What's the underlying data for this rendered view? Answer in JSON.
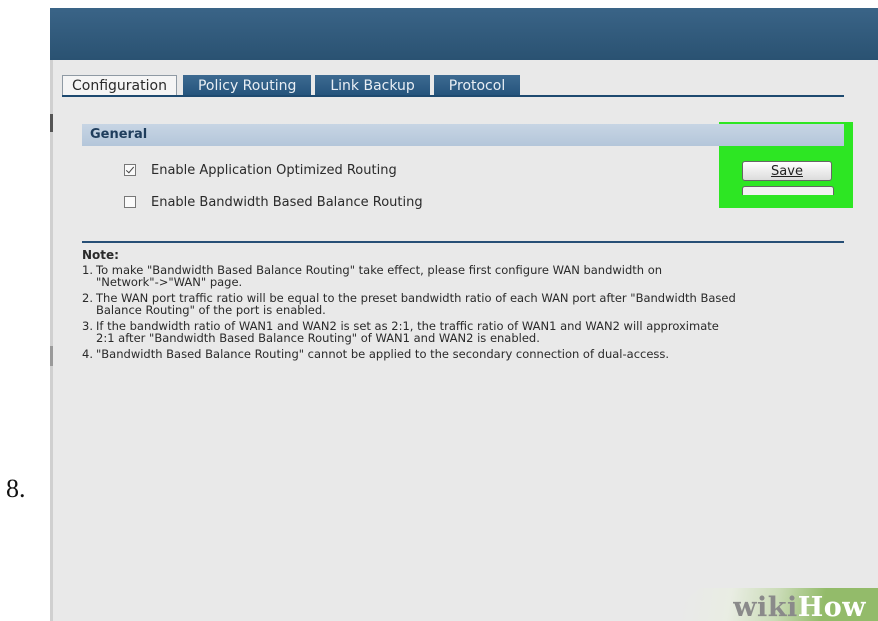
{
  "step_number": "8.",
  "tabs": [
    {
      "label": "Configuration",
      "active": true
    },
    {
      "label": "Policy Routing",
      "active": false
    },
    {
      "label": "Link Backup",
      "active": false
    },
    {
      "label": "Protocol",
      "active": false
    }
  ],
  "section": {
    "title": "General",
    "options": [
      {
        "label": "Enable Application Optimized Routing",
        "checked": true
      },
      {
        "label": "Enable Bandwidth Based Balance Routing",
        "checked": false
      }
    ],
    "save_label": "Save"
  },
  "note": {
    "title": "Note:",
    "items": [
      {
        "num": "1.",
        "text": "To make \"Bandwidth Based Balance Routing\" take effect, please first configure WAN bandwidth on\n\"Network\"->\"WAN\" page."
      },
      {
        "num": "2.",
        "text": "The WAN port traffic ratio will be equal to the preset bandwidth ratio of each WAN port after \"Bandwidth Based\nBalance Routing\" of the port is enabled."
      },
      {
        "num": "3.",
        "text": "If the bandwidth ratio of WAN1 and WAN2 is set as 2:1, the traffic ratio of WAN1 and WAN2 will approximate\n2:1 after \"Bandwidth Based Balance Routing\" of WAN1 and WAN2 is enabled."
      },
      {
        "num": "4.",
        "text": "\"Bandwidth Based Balance Routing\" cannot be applied to the secondary connection of dual-access."
      }
    ]
  },
  "watermark": {
    "wiki": "wiki",
    "how": "How"
  },
  "colors": {
    "highlight": "#2de623",
    "header_bar": "#2a5272",
    "tab_active": "#f5f5f5"
  }
}
